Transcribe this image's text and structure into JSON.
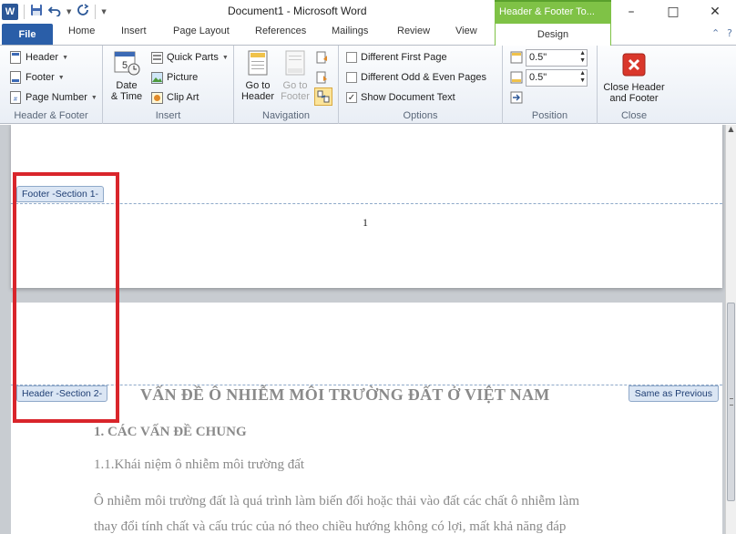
{
  "titlebar": {
    "app_logo": "W",
    "window_title": "Document1 - Microsoft Word",
    "context_tab_header": "Header & Footer To...",
    "icons": [
      "save-icon",
      "undo-icon",
      "redo-icon",
      "customize-qat-icon"
    ]
  },
  "window_controls": {
    "minimize": "–",
    "maximize": "□",
    "close": "✕"
  },
  "tabs": {
    "file": "File",
    "home": "Home",
    "insert": "Insert",
    "page_layout": "Page Layout",
    "references": "References",
    "mailings": "Mailings",
    "review": "Review",
    "view": "View",
    "design": "Design"
  },
  "ribbon": {
    "header_footer": {
      "label": "Header & Footer",
      "header": "Header",
      "footer": "Footer",
      "page_number": "Page Number"
    },
    "insert": {
      "label": "Insert",
      "date_time_line1": "Date",
      "date_time_line2": "& Time",
      "quick_parts": "Quick Parts",
      "picture": "Picture",
      "clip_art": "Clip Art"
    },
    "navigation": {
      "label": "Navigation",
      "goto_header_line1": "Go to",
      "goto_header_line2": "Header",
      "goto_footer_line1": "Go to",
      "goto_footer_line2": "Footer"
    },
    "options": {
      "label": "Options",
      "different_first_page": "Different First Page",
      "different_first_page_checked": false,
      "different_odd_even": "Different Odd & Even Pages",
      "different_odd_even_checked": false,
      "show_document_text": "Show Document Text",
      "show_document_text_checked": true
    },
    "position": {
      "label": "Position",
      "header_from_top": "0.5\"",
      "footer_from_bottom": "0.5\""
    },
    "close": {
      "label": "Close",
      "close_line1": "Close Header",
      "close_line2": "and Footer"
    }
  },
  "document": {
    "footer_tag": "Footer -Section 1-",
    "page_number": "1",
    "header_tag": "Header -Section 2-",
    "same_as_previous": "Same as Previous",
    "heading": "VẤN ĐỀ Ô NHIỄM MÔI TRƯỜNG ĐẤT Ở VIỆT NAM",
    "section_1": "1. CÁC VẤN ĐỀ CHUNG",
    "section_1_1": "1.1.Khái niệm ô nhiễm môi trường đất",
    "paragraph_line1": "Ô nhiễm môi trường đất là quá trình làm biến đổi hoặc thải vào đất các chất ô nhiễm làm",
    "paragraph_line2": "thay đổi tính chất và cấu trúc của nó theo chiều hướng không có lợi, mất khả năng đáp"
  },
  "colors": {
    "file_tab": "#2a5ea8",
    "context_tab": "#7fc246",
    "highlight": "#d9252b",
    "hf_tag_border": "#8fa9c9"
  }
}
